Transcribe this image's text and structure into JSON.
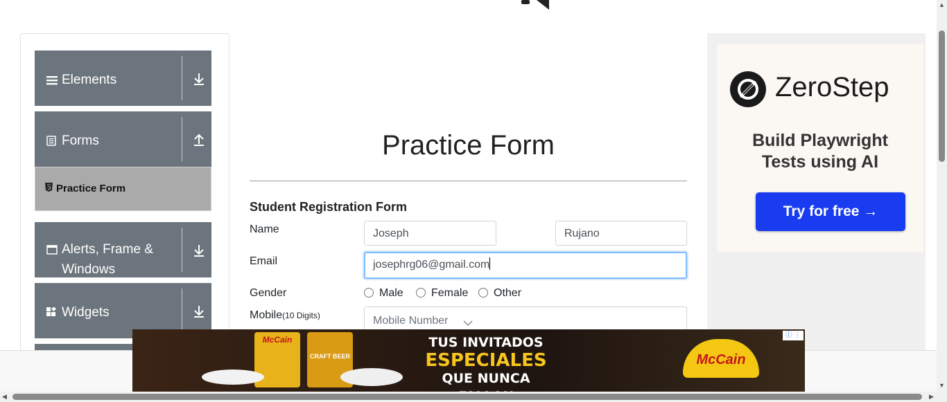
{
  "sidebar": {
    "groups": [
      {
        "label": "Elements",
        "icon": "menu-icon",
        "arrow": "download-arrow-icon"
      },
      {
        "label": "Forms",
        "icon": "document-icon",
        "arrow": "upload-arrow-icon"
      },
      {
        "label": "Alerts, Frame & Windows",
        "icon": "window-icon",
        "arrow": "download-arrow-icon"
      },
      {
        "label": "Widgets",
        "icon": "widgets-icon",
        "arrow": "download-arrow-icon"
      }
    ],
    "active_item": {
      "label": "Practice Form",
      "icon": "html5-icon"
    }
  },
  "form": {
    "title": "Practice Form",
    "subtitle": "Student Registration Form",
    "name_label": "Name",
    "first_name_value": "Joseph",
    "last_name_value": "Rujano",
    "email_label": "Email",
    "email_value": "josephrg06@gmail.com",
    "gender_label": "Gender",
    "gender_options": [
      "Male",
      "Female",
      "Other"
    ],
    "mobile_label": "Mobile",
    "mobile_hint": "(10 Digits)",
    "mobile_placeholder": "Mobile Number"
  },
  "ad_right": {
    "brand": "ZeroStep",
    "tagline_line1": "Build Playwright",
    "tagline_line2": "Tests using AI",
    "cta": "Try for free →"
  },
  "ad_bottom": {
    "line1": "TUS INVITADOS",
    "line2": "ESPECIALES",
    "line3": "QUE NUNCA FALLAN",
    "brand": "McCain",
    "pack_label_1": "McCain",
    "pack_label_2": "CRAFT BEER"
  },
  "colors": {
    "sidebar_group": "#6c757d",
    "active_item": "#aaaaaa",
    "cta": "#1a3cf0",
    "focus_border": "#80bdff"
  }
}
